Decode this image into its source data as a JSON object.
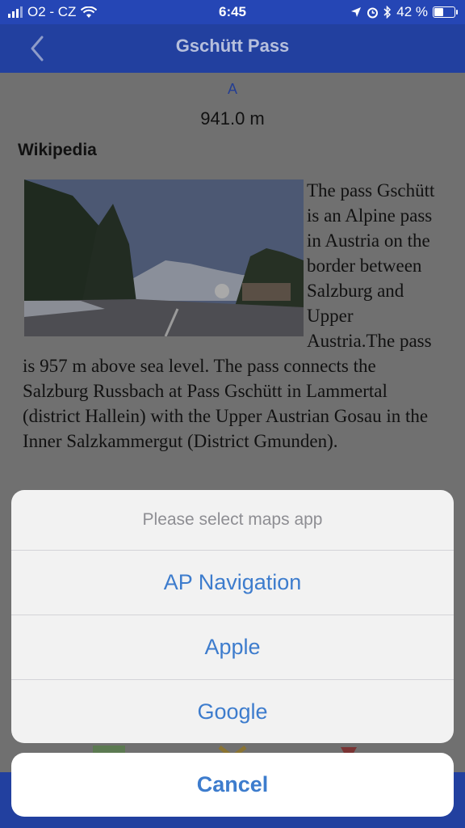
{
  "status_bar": {
    "carrier": "O2 - CZ",
    "time": "6:45",
    "battery_percent": "42 %",
    "battery_level": 0.42
  },
  "nav": {
    "title": "Gschütt Pass"
  },
  "content": {
    "marker_letter": "A",
    "elevation": "941.0 m",
    "wiki_heading": "Wikipedia",
    "wiki_text": "The pass Gschütt is an Alpine pass in Austria on the border between Salzburg and Upper Austria.The pass is 957 m above sea level. The pass connects the Salzburg Russbach at Pass Gschütt in Lammertal (district Hallein) with the Upper Austrian Gosau in the Inner Salzkammergut (District Gmunden)."
  },
  "action_sheet": {
    "title": "Please select maps app",
    "options": [
      {
        "label": "AP Navigation"
      },
      {
        "label": "Apple"
      },
      {
        "label": "Google"
      }
    ],
    "cancel_label": "Cancel"
  },
  "colors": {
    "nav_blue": "#22409f",
    "action_blue": "#3d7ccd"
  }
}
